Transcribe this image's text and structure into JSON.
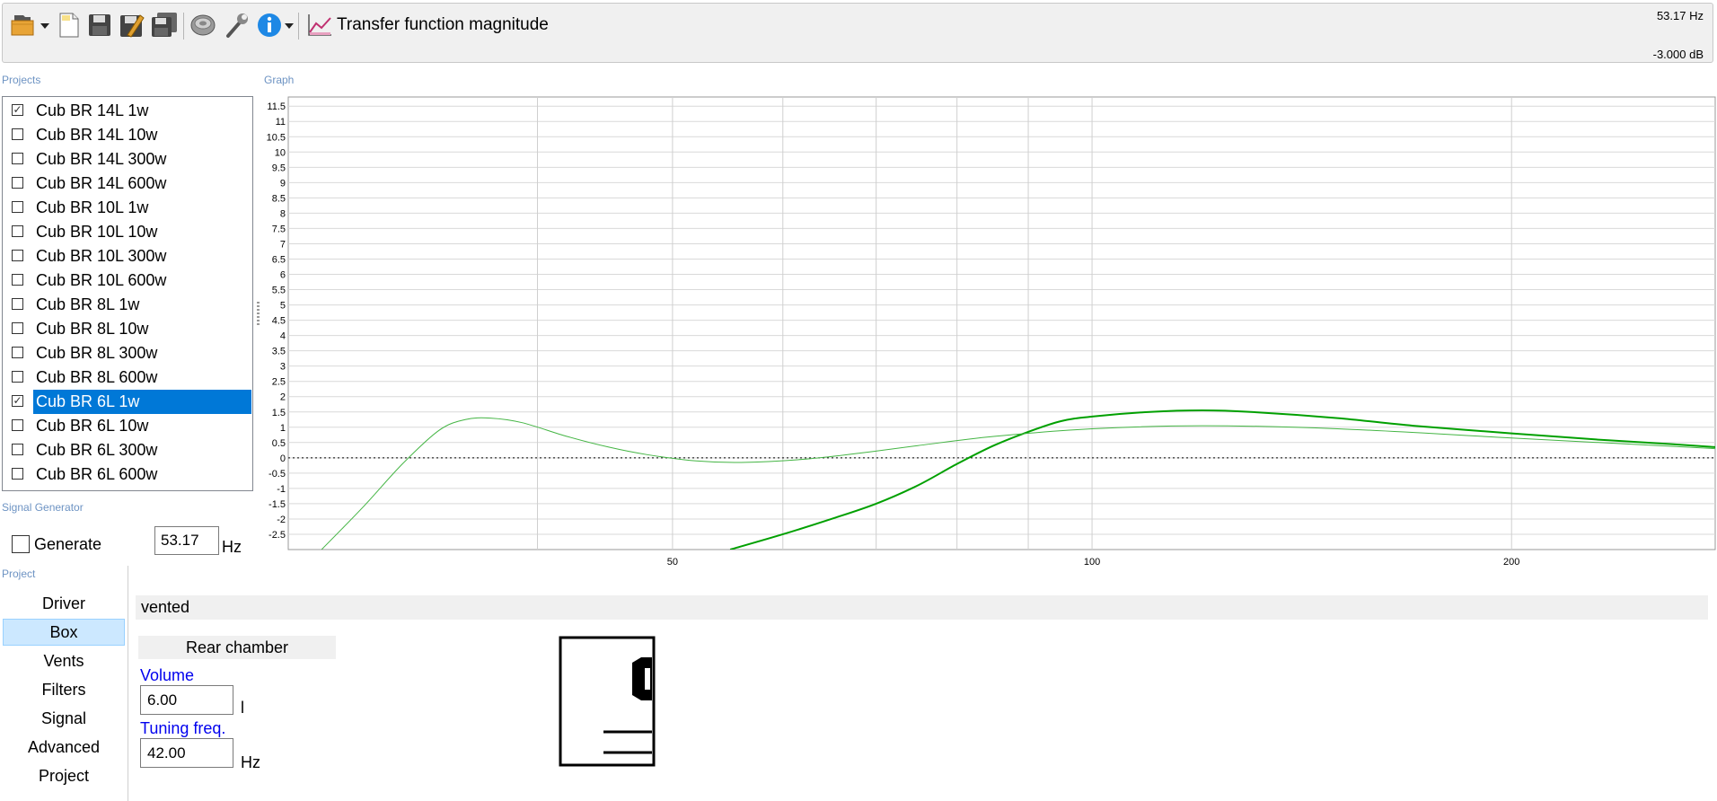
{
  "toolbar": {
    "title": "Transfer function magnitude",
    "readout_freq": "53.17 Hz",
    "readout_level": "-3.000 dB",
    "buttons": [
      "open-folder-icon",
      "new-document-icon",
      "save-icon",
      "save-edit-icon",
      "save-all-icon",
      "speaker-icon",
      "wrench-icon",
      "info-icon",
      "chart-icon"
    ],
    "colors": {
      "background": "#f0f0f0",
      "accent": "#0078d7",
      "info": "#1e88e5"
    }
  },
  "labels": {
    "projects": "Projects",
    "graph": "Graph",
    "signal_generator": "Signal Generator",
    "project": "Project"
  },
  "projects": [
    {
      "label": "Cub BR 14L 1w",
      "checked": true,
      "selected": false
    },
    {
      "label": "Cub BR 14L 10w",
      "checked": false,
      "selected": false
    },
    {
      "label": "Cub BR 14L 300w",
      "checked": false,
      "selected": false
    },
    {
      "label": "Cub BR 14L 600w",
      "checked": false,
      "selected": false
    },
    {
      "label": "Cub BR 10L 1w",
      "checked": false,
      "selected": false
    },
    {
      "label": "Cub BR 10L 10w",
      "checked": false,
      "selected": false
    },
    {
      "label": "Cub BR 10L 300w",
      "checked": false,
      "selected": false
    },
    {
      "label": "Cub BR 10L 600w",
      "checked": false,
      "selected": false
    },
    {
      "label": "Cub BR 8L 1w",
      "checked": false,
      "selected": false
    },
    {
      "label": "Cub BR 8L 10w",
      "checked": false,
      "selected": false
    },
    {
      "label": "Cub BR 8L 300w",
      "checked": false,
      "selected": false
    },
    {
      "label": "Cub BR 8L 600w",
      "checked": false,
      "selected": false
    },
    {
      "label": "Cub BR 6L 1w",
      "checked": true,
      "selected": true
    },
    {
      "label": "Cub BR 6L 10w",
      "checked": false,
      "selected": false
    },
    {
      "label": "Cub BR 6L 300w",
      "checked": false,
      "selected": false
    },
    {
      "label": "Cub BR 6L 600w",
      "checked": false,
      "selected": false
    }
  ],
  "signal_generator": {
    "generate_label": "Generate",
    "generate_checked": false,
    "frequency": "53.17",
    "unit": "Hz"
  },
  "chart_data": {
    "type": "line",
    "xscale": "log",
    "xlim": [
      26.5,
      280
    ],
    "ylim": [
      -3,
      11.8
    ],
    "y_ticks": [
      11.5,
      11,
      10.5,
      10,
      9.5,
      9,
      8.5,
      8,
      7.5,
      7,
      6.5,
      6,
      5.5,
      5,
      4.5,
      4,
      3.5,
      3,
      2.5,
      2,
      1.5,
      1,
      0.5,
      0,
      -0.5,
      -1,
      -1.5,
      -2,
      -2.5
    ],
    "y_tick_labels": [
      "11.5",
      "11",
      "10.5",
      "10",
      "9.5",
      "9",
      "8.5",
      "8",
      "7.5",
      "7",
      "6.5",
      "6",
      "5.5",
      "5",
      "4.5",
      "4",
      "3.5",
      "3",
      "2.5",
      "2",
      "1.5",
      "1",
      "0.5",
      "0",
      "-0.5",
      "-1",
      "-1.5",
      "-2",
      "-2.5"
    ],
    "x_tick_labels": [
      {
        "value": 50,
        "label": "50"
      },
      {
        "value": 100,
        "label": "100"
      },
      {
        "value": 200,
        "label": "200"
      }
    ],
    "x_gridlines": [
      40,
      50,
      60,
      70,
      80,
      90,
      100,
      200
    ],
    "reference_line": 0,
    "grid": true,
    "series": [
      {
        "color": "#00a000",
        "width": 2,
        "x": [
          55,
          60,
          65,
          70,
          75,
          80,
          85,
          90,
          95,
          100,
          110,
          120,
          130,
          150,
          170,
          200,
          230,
          260,
          280
        ],
        "y": [
          -3.0,
          -2.5,
          -2.0,
          -1.5,
          -0.9,
          -0.2,
          0.4,
          0.85,
          1.2,
          1.35,
          1.5,
          1.55,
          1.5,
          1.3,
          1.05,
          0.8,
          0.6,
          0.45,
          0.35
        ]
      },
      {
        "color": "#44b544",
        "width": 1,
        "x": [
          28,
          30,
          32,
          34,
          35.5,
          37,
          39,
          42,
          45,
          48,
          52,
          56,
          62,
          68,
          75,
          85,
          100,
          120,
          150,
          200,
          280
        ],
        "y": [
          -3.0,
          -1.6,
          -0.2,
          0.9,
          1.25,
          1.3,
          1.15,
          0.7,
          0.35,
          0.1,
          -0.1,
          -0.15,
          -0.05,
          0.15,
          0.4,
          0.7,
          0.95,
          1.05,
          0.95,
          0.65,
          0.3
        ]
      }
    ]
  },
  "project_tabs": [
    {
      "label": "Driver",
      "active": false
    },
    {
      "label": "Box",
      "active": true
    },
    {
      "label": "Vents",
      "active": false
    },
    {
      "label": "Filters",
      "active": false
    },
    {
      "label": "Signal",
      "active": false
    },
    {
      "label": "Advanced",
      "active": false
    },
    {
      "label": "Project",
      "active": false
    }
  ],
  "box": {
    "type": "vented",
    "rear_chamber_label": "Rear chamber",
    "volume_label": "Volume",
    "volume_value": "6.00",
    "volume_unit": "l",
    "tuning_label": "Tuning freq.",
    "tuning_value": "42.00",
    "tuning_unit": "Hz"
  }
}
